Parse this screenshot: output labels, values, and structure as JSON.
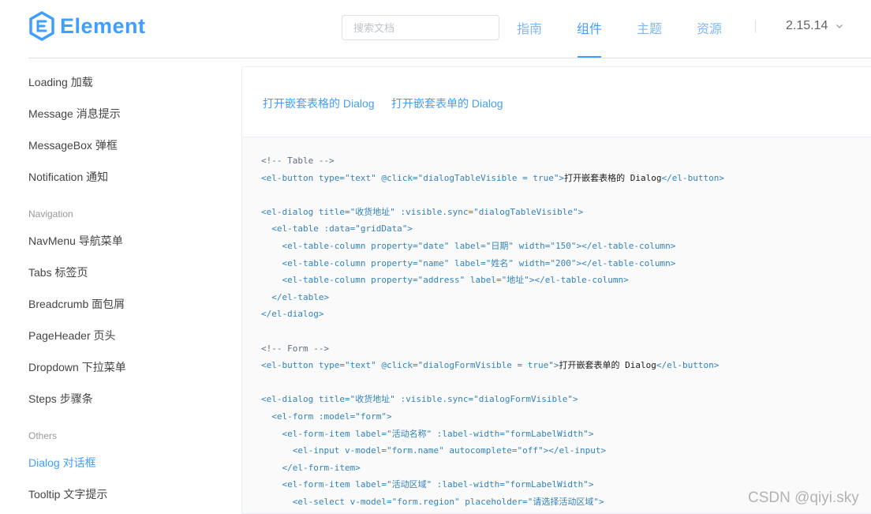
{
  "header": {
    "logo_text": "Element",
    "search_placeholder": "搜索文档",
    "nav": [
      {
        "label": "指南",
        "active": false
      },
      {
        "label": "组件",
        "active": true
      },
      {
        "label": "主题",
        "active": false
      },
      {
        "label": "资源",
        "active": false
      }
    ],
    "version": "2.15.14"
  },
  "sidebar": {
    "items": [
      {
        "label": "Loading 加载"
      },
      {
        "label": "Message 消息提示"
      },
      {
        "label": "MessageBox 弹框"
      },
      {
        "label": "Notification 通知"
      }
    ],
    "group_navigation": "Navigation",
    "nav_items": [
      {
        "label": "NavMenu 导航菜单"
      },
      {
        "label": "Tabs 标签页"
      },
      {
        "label": "Breadcrumb 面包屑"
      },
      {
        "label": "PageHeader 页头"
      },
      {
        "label": "Dropdown 下拉菜单"
      },
      {
        "label": "Steps 步骤条"
      }
    ],
    "group_others": "Others",
    "other_items": [
      {
        "label": "Dialog 对话框",
        "active": true
      },
      {
        "label": "Tooltip 文字提示"
      }
    ]
  },
  "demo": {
    "links": [
      "打开嵌套表格的 Dialog",
      "打开嵌套表单的 Dialog"
    ],
    "code": [
      {
        "parts": [
          {
            "t": "<!-- Table -->",
            "c": "comment"
          }
        ]
      },
      {
        "parts": [
          {
            "t": "<el-button type=\"text\" @click=\"dialogTableVisible = true\">",
            "c": "tag"
          },
          {
            "t": "打开嵌套表格的 Dialog",
            "c": "text"
          },
          {
            "t": "</el-button>",
            "c": "tag"
          }
        ]
      },
      {
        "parts": []
      },
      {
        "parts": [
          {
            "t": "<el-dialog title=\"收货地址\" :visible.sync=\"dialogTableVisible\">",
            "c": "tag"
          }
        ]
      },
      {
        "parts": [
          {
            "t": "  <el-table :data=\"gridData\">",
            "c": "tag"
          }
        ]
      },
      {
        "parts": [
          {
            "t": "    <el-table-column property=\"date\" label=\"日期\" width=\"150\"></el-table-column>",
            "c": "tag"
          }
        ]
      },
      {
        "parts": [
          {
            "t": "    <el-table-column property=\"name\" label=\"姓名\" width=\"200\"></el-table-column>",
            "c": "tag"
          }
        ]
      },
      {
        "parts": [
          {
            "t": "    <el-table-column property=\"address\" label=\"地址\"></el-table-column>",
            "c": "tag"
          }
        ]
      },
      {
        "parts": [
          {
            "t": "  </el-table>",
            "c": "tag"
          }
        ]
      },
      {
        "parts": [
          {
            "t": "</el-dialog>",
            "c": "tag"
          }
        ]
      },
      {
        "parts": []
      },
      {
        "parts": [
          {
            "t": "<!-- Form -->",
            "c": "comment"
          }
        ]
      },
      {
        "parts": [
          {
            "t": "<el-button type=\"text\" @click=\"dialogFormVisible = true\">",
            "c": "tag"
          },
          {
            "t": "打开嵌套表单的 Dialog",
            "c": "text"
          },
          {
            "t": "</el-button>",
            "c": "tag"
          }
        ]
      },
      {
        "parts": []
      },
      {
        "parts": [
          {
            "t": "<el-dialog title=\"收货地址\" :visible.sync=\"dialogFormVisible\">",
            "c": "tag"
          }
        ]
      },
      {
        "parts": [
          {
            "t": "  <el-form :model=\"form\">",
            "c": "tag"
          }
        ]
      },
      {
        "parts": [
          {
            "t": "    <el-form-item label=\"活动名称\" :label-width=\"formLabelWidth\">",
            "c": "tag"
          }
        ]
      },
      {
        "parts": [
          {
            "t": "      <el-input v-model=\"form.name\" autocomplete=\"off\"></el-input>",
            "c": "tag"
          }
        ]
      },
      {
        "parts": [
          {
            "t": "    </el-form-item>",
            "c": "tag"
          }
        ]
      },
      {
        "parts": [
          {
            "t": "    <el-form-item label=\"活动区域\" :label-width=\"formLabelWidth\">",
            "c": "tag"
          }
        ]
      },
      {
        "parts": [
          {
            "t": "      <el-select v-model=\"form.region\" placeholder=\"请选择活动区域\">",
            "c": "tag"
          }
        ]
      }
    ]
  },
  "watermark": "CSDN @qiyi.sky",
  "colors": {
    "accent": "#409eff",
    "code_tag": "#3182bd",
    "code_comment": "#5e6d82"
  }
}
